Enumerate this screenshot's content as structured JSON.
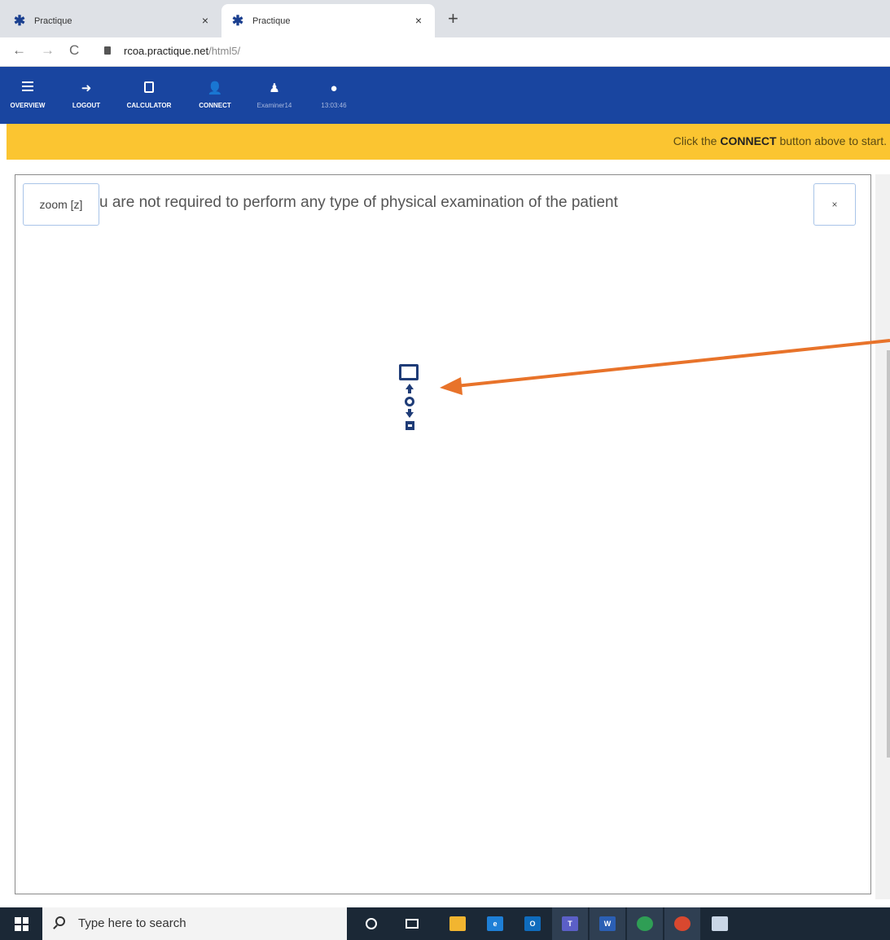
{
  "browser": {
    "tabs": [
      {
        "title": "Practique",
        "close": "×"
      },
      {
        "title": "Practique",
        "close": "×"
      }
    ],
    "new_tab": "+",
    "nav": {
      "back": "←",
      "forward": "→",
      "reload": "C"
    },
    "url_host": "rcoa.practique.net",
    "url_path": "/html5/"
  },
  "appbar": {
    "buttons": [
      {
        "label": "OVERVIEW",
        "icon": "list-icon"
      },
      {
        "label": "LOGOUT",
        "icon": "logout-icon"
      },
      {
        "label": "CALCULATOR",
        "icon": "calculator-icon"
      },
      {
        "label": "CONNECT",
        "icon": "add-user-icon"
      },
      {
        "label": "Examiner14",
        "icon": "user-icon"
      },
      {
        "label": "13:03:46",
        "icon": "clock-icon"
      }
    ],
    "color": "#1945a0"
  },
  "notice": {
    "before": "Click the ",
    "strong": "CONNECT",
    "after": " button above to start.",
    "color": "#fbc531"
  },
  "panel": {
    "zoom_label": "zoom [z]",
    "text": "u are not required to perform any type of physical examination of the patient",
    "close_label": "×"
  },
  "annotation": {
    "arrow_color": "#e8732a"
  },
  "taskbar": {
    "search_placeholder": "Type here to search",
    "apps": [
      {
        "name": "file-explorer-icon",
        "color": "#f2b530",
        "text": ""
      },
      {
        "name": "edge-icon",
        "color": "#1e7fd6",
        "text": "e"
      },
      {
        "name": "outlook-icon",
        "color": "#0f6cbd",
        "text": "O"
      },
      {
        "name": "teams-icon",
        "color": "#5b5fc7",
        "text": "T"
      },
      {
        "name": "word-icon",
        "color": "#2b5fb4",
        "text": "W"
      },
      {
        "name": "chrome-icon",
        "color": "#2f9e55",
        "text": ""
      },
      {
        "name": "chrome-profile-icon",
        "color": "#d9482f",
        "text": ""
      },
      {
        "name": "paint-icon",
        "color": "#c9d6e6",
        "text": ""
      }
    ]
  }
}
